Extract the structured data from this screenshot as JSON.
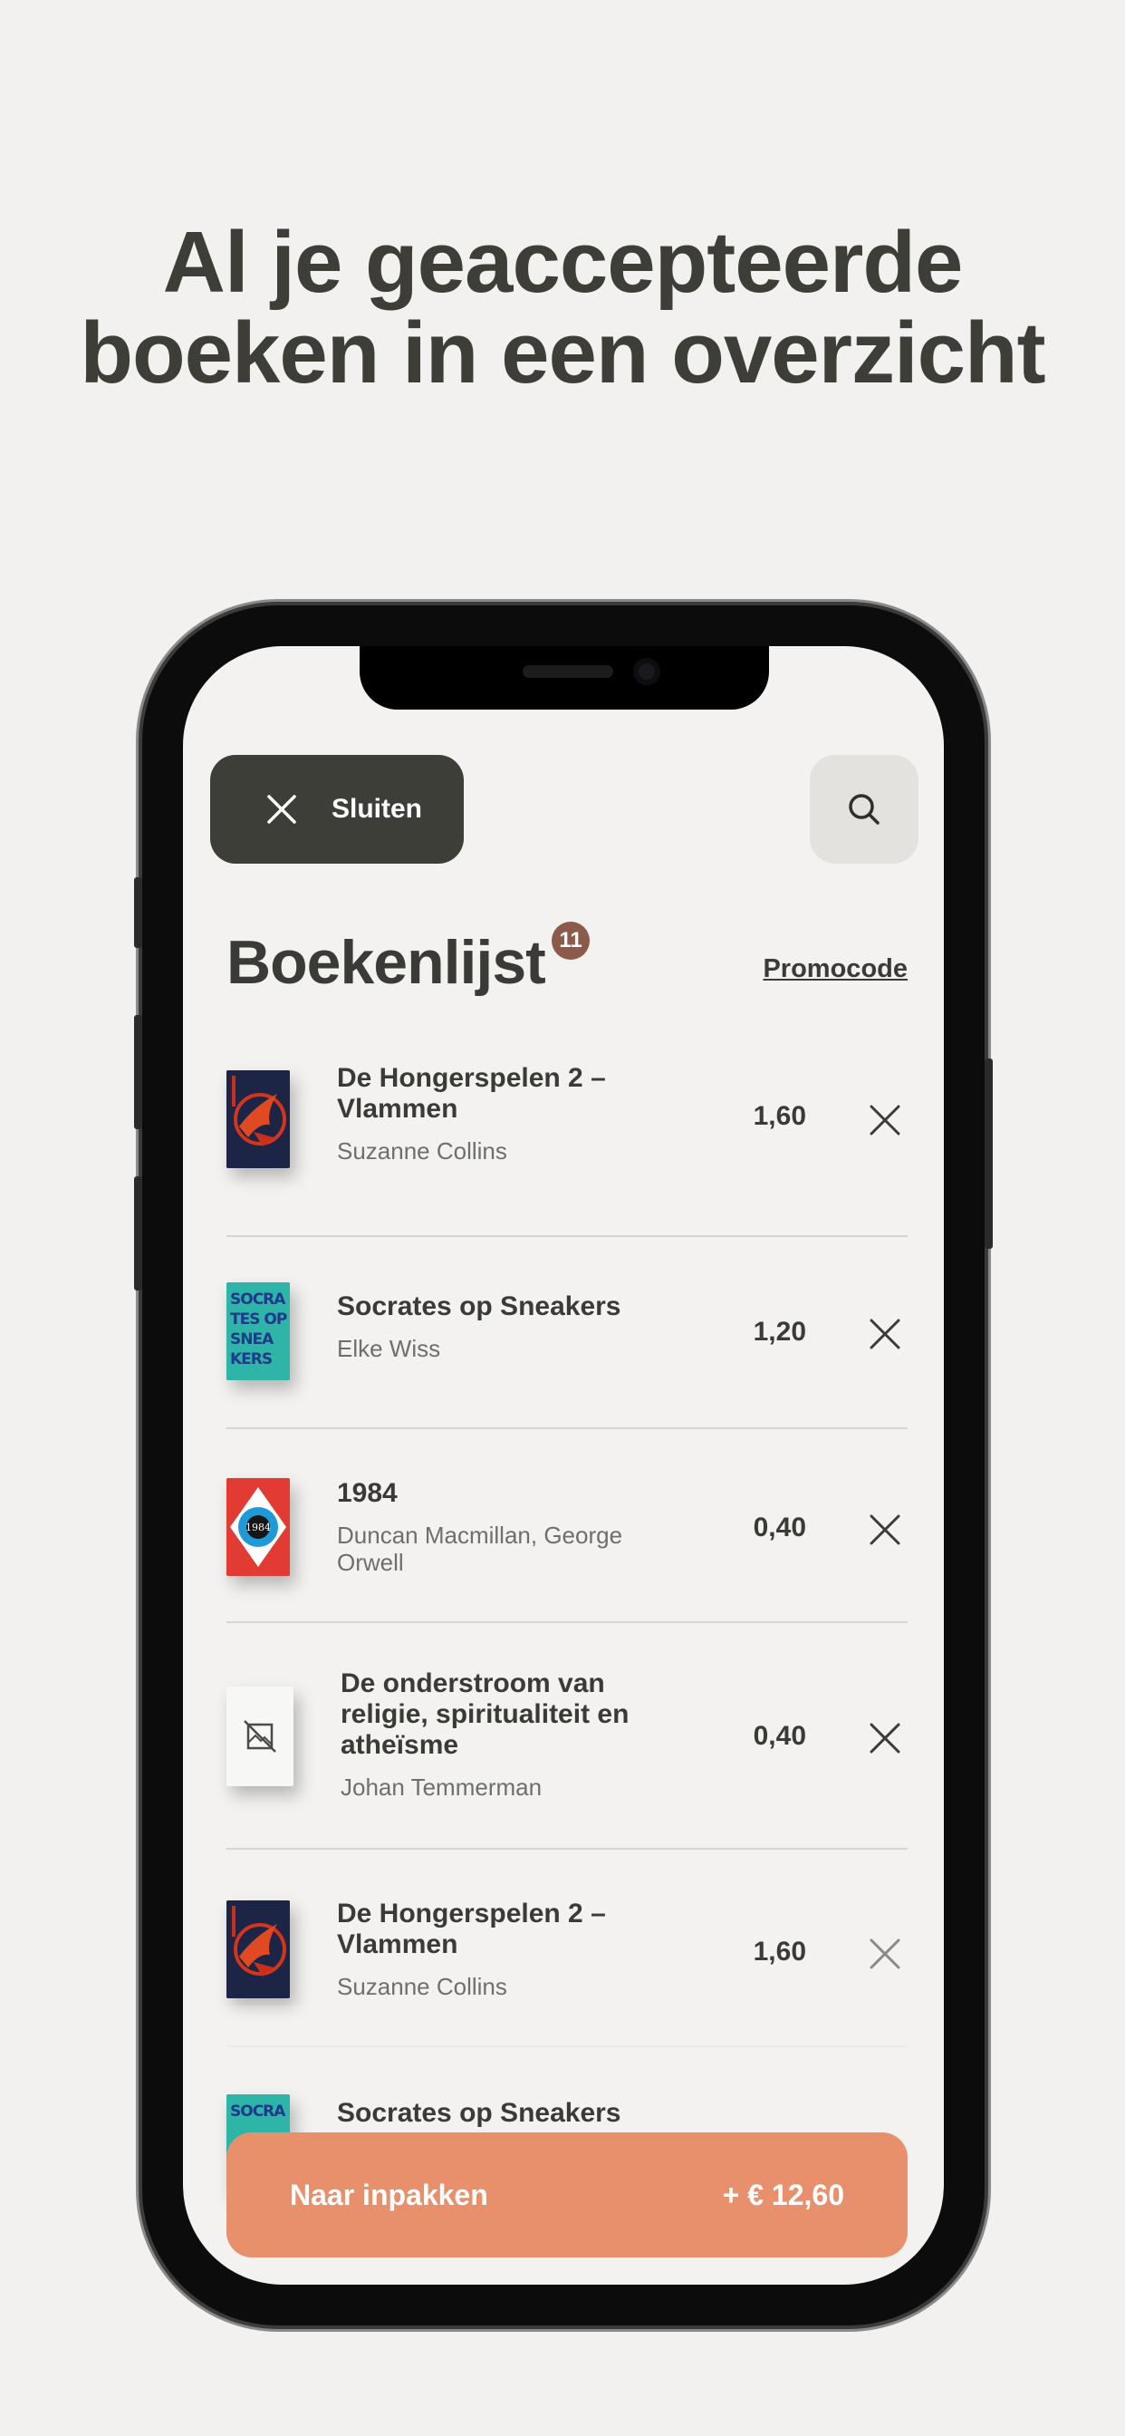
{
  "headline": {
    "line1": "Al je geaccepteerde",
    "line2": "boeken in een overzicht"
  },
  "header": {
    "close_label": "Sluiten",
    "close_icon": "close-icon",
    "search_icon": "search-icon"
  },
  "booklist": {
    "title": "Boekenlijst",
    "count": "11",
    "promo_label": "Promocode"
  },
  "books": [
    {
      "title": "De Hongerspelen 2 – Vlammen",
      "author": "Suzanne Collins",
      "price": "1,60",
      "cover": "hunger-games-cover"
    },
    {
      "title": "Socrates op Sneakers",
      "author": "Elke Wiss",
      "price": "1,20",
      "cover": "socrates-cover"
    },
    {
      "title": "1984",
      "author": "Duncan Macmillan, George Orwell",
      "price": "0,40",
      "cover": "1984-cover"
    },
    {
      "title": "De onderstroom van religie, spiritualiteit en atheïsme",
      "author": "Johan Temmerman",
      "price": "0,40",
      "cover": "no-image-icon"
    },
    {
      "title": "De Hongerspelen 2 – Vlammen",
      "author": "Suzanne Collins",
      "price": "1,60",
      "cover": "hunger-games-cover"
    },
    {
      "title": "Socrates op Sneakers",
      "author": "",
      "price": "",
      "cover": "socrates-cover"
    }
  ],
  "cover_text": {
    "socrates": "SOCRA TES OP SNEA KERS",
    "orwell": "1984"
  },
  "footer": {
    "cta_label": "Naar inpakken",
    "cta_total": "+ € 12,60"
  },
  "colors": {
    "background": "#f2f1ef",
    "dark_button": "#3d3e38",
    "badge": "#8c5a4a",
    "cta": "#e8906c"
  }
}
